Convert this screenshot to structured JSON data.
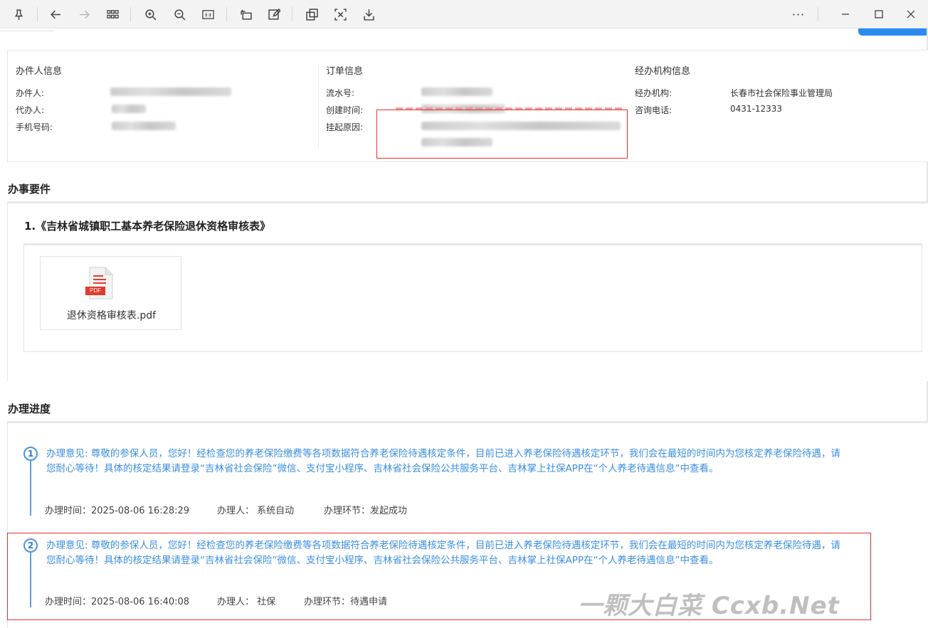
{
  "toolbar": {
    "items": [
      "pin-icon",
      "back-icon",
      "forward-icon",
      "grid-icon",
      "zoom-in-icon",
      "zoom-out-icon",
      "actual-size-icon",
      "rotate-icon",
      "edit-icon",
      "copy-icon",
      "close-doc-icon",
      "download-icon"
    ],
    "more_label": "···"
  },
  "info": {
    "handler": {
      "title": "办件人信息",
      "rows": [
        {
          "label": "办件人:"
        },
        {
          "label": "代办人:"
        },
        {
          "label": "手机号码:"
        }
      ]
    },
    "order": {
      "title": "订单信息",
      "rows": [
        {
          "label": "流水号:"
        },
        {
          "label": "创建时间:"
        },
        {
          "label": "挂起原因:"
        }
      ]
    },
    "agency": {
      "title": "经办机构信息",
      "rows": [
        {
          "label": "经办机构:",
          "value": "长春市社会保险事业管理局"
        },
        {
          "label": "咨询电话:",
          "value": "0431-12333"
        }
      ]
    }
  },
  "materials": {
    "section_title": "办事要件",
    "item_title": "1.《吉林省城镇职工基本养老保险退休资格审核表》",
    "file": {
      "name": "退休资格审核表.pdf",
      "badge": "PDF"
    }
  },
  "progress": {
    "section_title": "办理进度",
    "steps": [
      {
        "num": "1",
        "opinion": "办理意见:  尊敬的参保人员，您好！经检查您的养老保险缴费等各项数据符合养老保险待遇核定条件，目前已进入养老保险待遇核定环节，我们会在最短的时间内为您核定养老保险待遇，请您耐心等待！具体的核定结果请登录“吉林省社会保险”微信、支付宝小程序、吉林省社会保险公共服务平台、吉林掌上社保APP在“个人养老待遇信息”中查看。",
        "time": "办理时间：2025-08-06 16:28:29",
        "person": "办理人：  系统自动",
        "stage": "办理环节：发起成功"
      },
      {
        "num": "2",
        "opinion": "办理意见:  尊敬的参保人员，您好！经检查您的养老保险缴费等各项数据符合养老保险待遇核定条件，目前已进入养老保险待遇核定环节，我们会在最短的时间内为您核定养老保险待遇，请您耐心等待！具体的核定结果请登录“吉林省社会保险”微信、支付宝小程序、吉林省社会保险公共服务平台、吉林掌上社保APP在“个人养老待遇信息”中查看。",
        "time": "办理时间：2025-08-06 16:40:08",
        "person": "办理人：  社保",
        "stage": "办理环节：待遇申请"
      }
    ]
  },
  "watermark": "一颗大白菜 Ccxb.Net"
}
